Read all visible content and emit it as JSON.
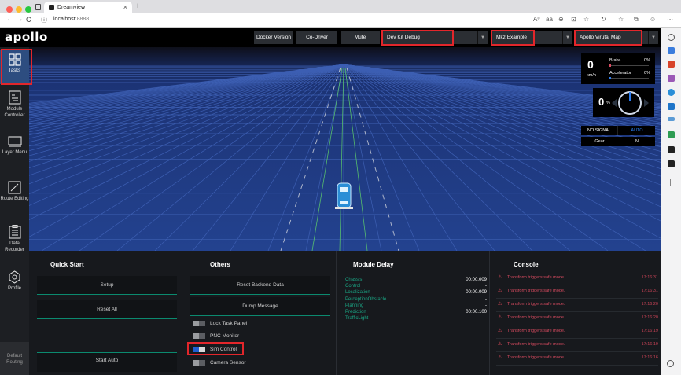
{
  "browser": {
    "tab_title": "Dreamview",
    "tab_close": "×",
    "new_tab": "+",
    "url_host": "localhost",
    "url_port": ":8888",
    "nav_back": "←",
    "nav_forward": "→",
    "nav_reload": "C",
    "info_icon": "ⓘ",
    "toolbar_icons": [
      "A⁰",
      "aa",
      "⊕",
      "⊡",
      "☆",
      "↻",
      "☆",
      "⧉",
      "☺",
      "⋯"
    ]
  },
  "topbar": {
    "logo": "apollo",
    "buttons": [
      "Docker Version",
      "Co-Driver",
      "Mute"
    ],
    "selects": [
      {
        "label": "Dev Kit Debug",
        "caret": "▼"
      },
      {
        "label": "Mkz Example",
        "caret": "▼"
      },
      {
        "label": "Apollo Virutal Map",
        "caret": "▼"
      }
    ]
  },
  "sidebar": {
    "items": [
      {
        "label": "Tasks",
        "icon": "grid-icon"
      },
      {
        "label": "Module Controller",
        "icon": "module-controller-icon"
      },
      {
        "label": "Layer Menu",
        "icon": "layer-menu-icon"
      },
      {
        "label": "Route Editing",
        "icon": "route-editing-icon"
      },
      {
        "label": "Data Recorder",
        "icon": "data-recorder-icon"
      },
      {
        "label": "Profile",
        "icon": "profile-icon"
      }
    ],
    "default_routing": "Default Routing"
  },
  "hud": {
    "speed": "0",
    "speed_unit": "km/h",
    "brake_label": "Brake",
    "brake_value": "0%",
    "accel_label": "Accelerator",
    "accel_value": "0%",
    "steer_value": "0",
    "steer_unit": "%",
    "signal": "NO SIGNAL",
    "mode": "AUTO",
    "gear_label": "Gear",
    "gear_value": "N"
  },
  "quick_start": {
    "title": "Quick Start",
    "buttons": [
      "Setup",
      "Reset All",
      "Start Auto"
    ]
  },
  "others": {
    "title": "Others",
    "buttons": [
      "Reset Backend Data",
      "Dump Message"
    ],
    "toggles": [
      {
        "label": "Lock Task Panel",
        "on": false
      },
      {
        "label": "PNC Monitor",
        "on": false
      },
      {
        "label": "Sim Control",
        "on": true
      },
      {
        "label": "Camera Sensor",
        "on": false
      }
    ]
  },
  "module_delay": {
    "title": "Module Delay",
    "rows": [
      {
        "name": "Chassis",
        "value": "00:00.009"
      },
      {
        "name": "Control",
        "value": "-"
      },
      {
        "name": "Localization",
        "value": "00:00.009"
      },
      {
        "name": "PerceptionObstacle",
        "value": "-"
      },
      {
        "name": "Planning",
        "value": "-"
      },
      {
        "name": "Prediction",
        "value": "00:00.100"
      },
      {
        "name": "TrafficLight",
        "value": "-"
      }
    ]
  },
  "console": {
    "title": "Console",
    "rows": [
      {
        "msg": "Transform triggers safe mode.",
        "time": "17:16:31"
      },
      {
        "msg": "Transform triggers safe mode.",
        "time": "17:16:31"
      },
      {
        "msg": "Transform triggers safe mode.",
        "time": "17:16:20"
      },
      {
        "msg": "Transform triggers safe mode.",
        "time": "17:16:20"
      },
      {
        "msg": "Transform triggers safe mode.",
        "time": "17:16:19"
      },
      {
        "msg": "Transform triggers safe mode.",
        "time": "17:16:19"
      },
      {
        "msg": "Transform triggers safe mode.",
        "time": "17:16:16"
      }
    ]
  },
  "colors": {
    "highlight_box": "#e3262b",
    "scene_bg": "#1b2f6e",
    "accent_green": "#1aa886",
    "console_error": "#d94b60"
  }
}
